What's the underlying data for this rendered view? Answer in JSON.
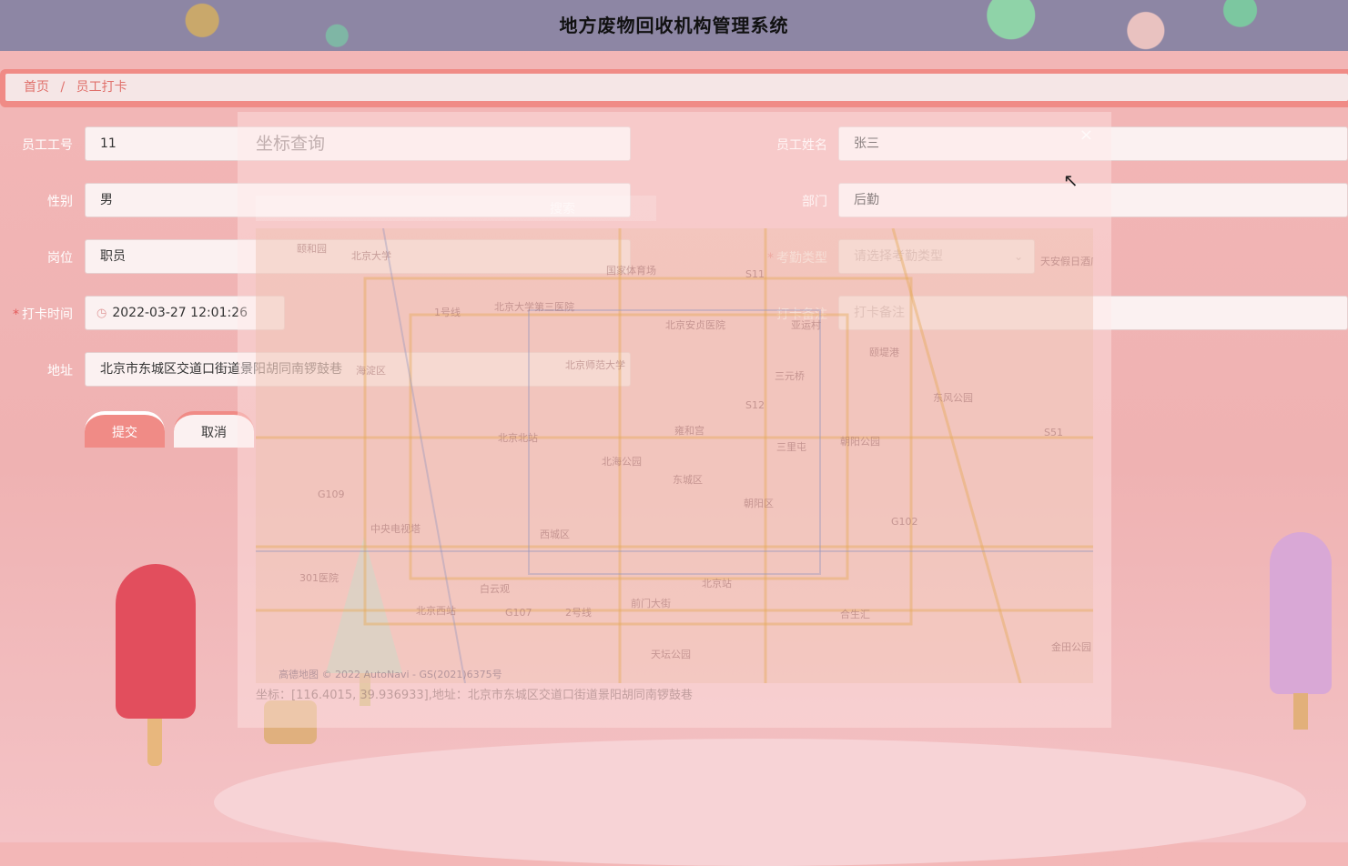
{
  "app": {
    "title": "地方废物回收机构管理系统"
  },
  "breadcrumb": {
    "home": "首页",
    "separator": "/",
    "current": "员工打卡"
  },
  "form": {
    "employee_no": {
      "label": "员工工号",
      "value": "11"
    },
    "employee_name": {
      "label": "员工姓名",
      "value": "张三"
    },
    "gender": {
      "label": "性别",
      "value": "男"
    },
    "department": {
      "label": "部门",
      "value": "后勤"
    },
    "position": {
      "label": "岗位",
      "value": "职员"
    },
    "attendance_type": {
      "label": "考勤类型",
      "placeholder": "请选择考勤类型",
      "required": "*"
    },
    "clock_time": {
      "label": "打卡时间",
      "value": "2022-03-27 12:01:26",
      "required": "*"
    },
    "remark": {
      "label": "打卡备注",
      "placeholder": "打卡备注"
    },
    "address": {
      "label": "地址",
      "value": "北京市东城区交道口街道景阳胡同南锣鼓巷"
    },
    "submit_label": "提交",
    "cancel_label": "取消"
  },
  "modal": {
    "title": "坐标查询",
    "search_label": "搜索",
    "close_icon": "×",
    "map_copyright": "高德地图 © 2022 AutoNavi - GS(2021)6375号",
    "coordinate_text": "坐标：[116.4015, 39.936933],地址：北京市东城区交道口街道景阳胡同南锣鼓巷",
    "map_labels": [
      "颐和园",
      "北京大学",
      "国家体育场",
      "北京大学第三医院",
      "北京安贞医院",
      "北京师范大学",
      "海淀区",
      "东城区",
      "西城区",
      "朝阳区",
      "北京北站",
      "雍和宫",
      "北海公园",
      "中央电视塔",
      "301医院",
      "白云观",
      "北京西站",
      "前门大街",
      "北京站",
      "天坛公园",
      "三元桥",
      "东风公园",
      "朝阳公园",
      "合生汇",
      "金田公园",
      "颐堤港",
      "亚运村",
      "天安假日酒店",
      "G109",
      "G107",
      "G102",
      "S11",
      "S12",
      "S51",
      "1号线",
      "2号线",
      "三里屯"
    ]
  }
}
